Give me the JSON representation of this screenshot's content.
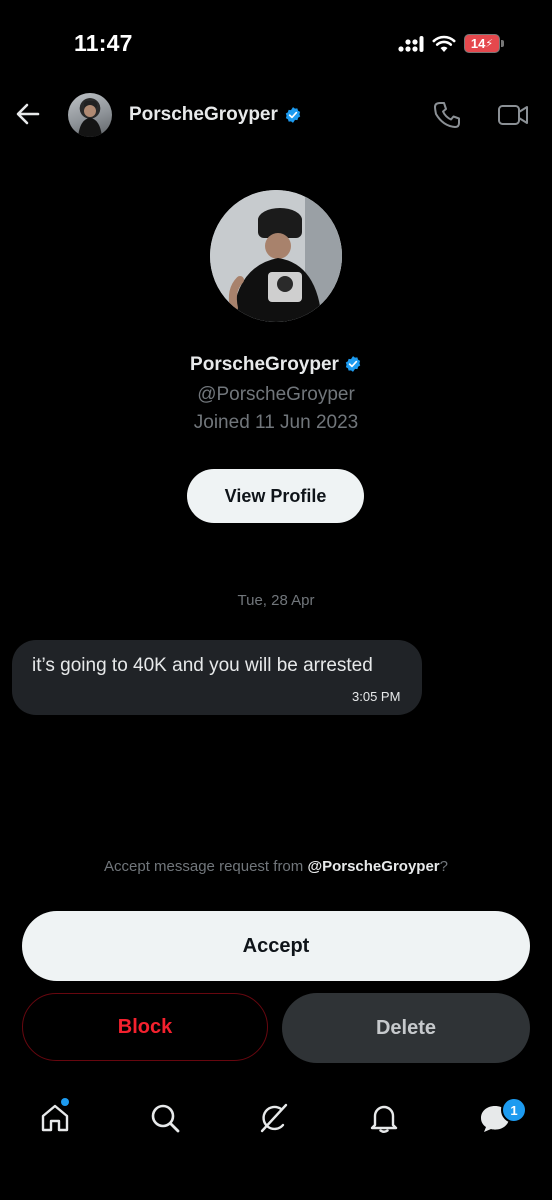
{
  "status_bar": {
    "time": "11:47",
    "battery": "14"
  },
  "header": {
    "name": "PorscheGroyper"
  },
  "profile": {
    "name": "PorscheGroyper",
    "handle": "@PorscheGroyper",
    "joined": "Joined 11 Jun 2023",
    "view_profile_label": "View Profile"
  },
  "conversation": {
    "date_separator": "Tue, 28 Apr",
    "messages": [
      {
        "text": "it’s going to 40K and you will be arrested",
        "time": "3:05 PM"
      }
    ]
  },
  "request": {
    "prompt_prefix": "Accept message request from ",
    "prompt_handle": "@PorscheGroyper",
    "prompt_suffix": "?",
    "accept_label": "Accept",
    "block_label": "Block",
    "delete_label": "Delete"
  },
  "nav": {
    "messages_badge": "1"
  },
  "icons": {
    "back": "arrow-left-icon",
    "verified": "verified-badge-icon",
    "call": "phone-icon",
    "video": "video-camera-icon",
    "home": "home-icon",
    "search": "search-icon",
    "grok": "slash-circle-icon",
    "notifications": "bell-icon",
    "messages": "chat-bubble-icon"
  },
  "colors": {
    "accent": "#1d9bf0",
    "danger": "#f4212e",
    "background": "#000000"
  }
}
